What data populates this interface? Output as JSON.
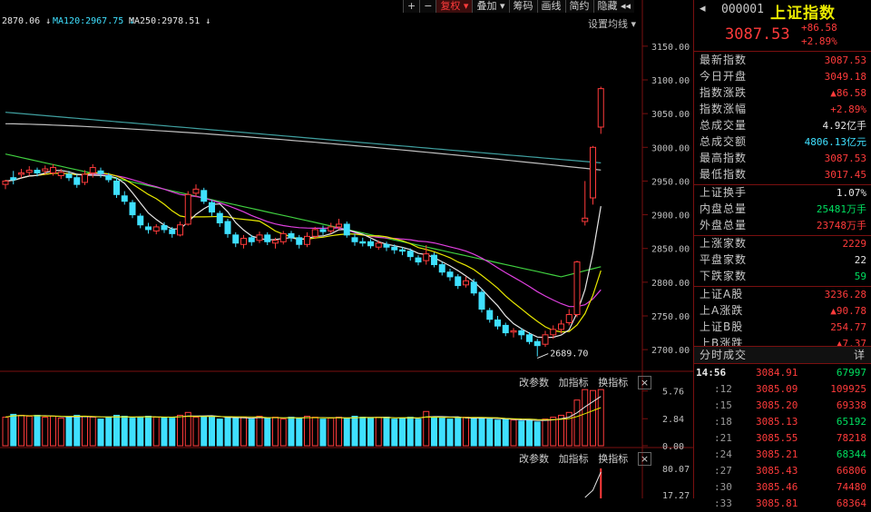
{
  "toolbar": {
    "items": [
      {
        "label": "+",
        "active": false
      },
      {
        "label": "−",
        "active": false
      },
      {
        "label": "复权 ▾",
        "active": true
      },
      {
        "label": "叠加 ▾",
        "active": false
      },
      {
        "label": "筹码",
        "active": false
      },
      {
        "label": "画线",
        "active": false
      },
      {
        "label": "简约",
        "active": false
      },
      {
        "label": "隐藏 ◂◂",
        "active": false
      }
    ]
  },
  "ma_legend": {
    "ma_a": "2870.06 ↓",
    "ma120": "MA120:2967.75 ↓",
    "ma250": "MA250:2978.51 ↓"
  },
  "settings_label": "设置均线 ▾",
  "price_axis": [
    "3150.00",
    "3100.00",
    "3050.00",
    "3000.00",
    "2950.00",
    "2900.00",
    "2850.00",
    "2800.00",
    "2750.00",
    "2700.00"
  ],
  "low_marker": "2689.70",
  "volume_axis": [
    "5.76",
    "2.84",
    "0.00"
  ],
  "indicator_axis": [
    "80.07",
    "17.27"
  ],
  "sub_toolbar": {
    "edit_params": "改参数",
    "add_indicator": "加指标",
    "switch_indicator": "换指标",
    "close": "×"
  },
  "colors": {
    "up": "#ff3b3b",
    "down": "#3fe0ff",
    "ma5": "#e6e6e6",
    "ma10": "#e8e800",
    "ma20": "#e040e0",
    "ma60": "#40d040",
    "ma120": "#bfbfbf",
    "ma250": "#40a0a0"
  },
  "chart_data": {
    "type": "candlestick",
    "ylim": [
      2680,
      3170
    ],
    "candles": [
      [
        2945,
        2950,
        2938,
        2952
      ],
      [
        2955,
        2952,
        2945,
        2965
      ],
      [
        2960,
        2962,
        2955,
        2968
      ],
      [
        2963,
        2966,
        2958,
        2972
      ],
      [
        2966,
        2962,
        2957,
        2970
      ],
      [
        2965,
        2968,
        2960,
        2973
      ],
      [
        2962,
        2970,
        2958,
        2975
      ],
      [
        2958,
        2963,
        2953,
        2968
      ],
      [
        2960,
        2955,
        2950,
        2965
      ],
      [
        2955,
        2945,
        2940,
        2960
      ],
      [
        2948,
        2960,
        2944,
        2966
      ],
      [
        2962,
        2970,
        2955,
        2975
      ],
      [
        2965,
        2961,
        2955,
        2970
      ],
      [
        2958,
        2952,
        2948,
        2962
      ],
      [
        2950,
        2930,
        2925,
        2955
      ],
      [
        2928,
        2920,
        2915,
        2935
      ],
      [
        2918,
        2900,
        2895,
        2922
      ],
      [
        2898,
        2885,
        2880,
        2902
      ],
      [
        2882,
        2878,
        2872,
        2888
      ],
      [
        2876,
        2882,
        2871,
        2886
      ],
      [
        2884,
        2878,
        2873,
        2889
      ],
      [
        2878,
        2872,
        2866,
        2882
      ],
      [
        2870,
        2885,
        2868,
        2890
      ],
      [
        2886,
        2930,
        2884,
        2935
      ],
      [
        2932,
        2938,
        2926,
        2945
      ],
      [
        2936,
        2920,
        2916,
        2940
      ],
      [
        2918,
        2904,
        2898,
        2922
      ],
      [
        2902,
        2888,
        2882,
        2906
      ],
      [
        2890,
        2872,
        2866,
        2894
      ],
      [
        2870,
        2858,
        2852,
        2874
      ],
      [
        2856,
        2865,
        2850,
        2870
      ],
      [
        2866,
        2860,
        2854,
        2870
      ],
      [
        2862,
        2870,
        2858,
        2875
      ],
      [
        2870,
        2860,
        2855,
        2874
      ],
      [
        2858,
        2862,
        2850,
        2866
      ],
      [
        2860,
        2872,
        2856,
        2876
      ],
      [
        2872,
        2866,
        2860,
        2876
      ],
      [
        2866,
        2856,
        2850,
        2870
      ],
      [
        2856,
        2868,
        2852,
        2874
      ],
      [
        2868,
        2878,
        2864,
        2882
      ],
      [
        2878,
        2875,
        2870,
        2884
      ],
      [
        2876,
        2882,
        2872,
        2888
      ],
      [
        2882,
        2886,
        2878,
        2894
      ],
      [
        2886,
        2870,
        2866,
        2890
      ],
      [
        2866,
        2860,
        2854,
        2872
      ],
      [
        2860,
        2858,
        2853,
        2866
      ],
      [
        2860,
        2854,
        2850,
        2864
      ],
      [
        2852,
        2858,
        2848,
        2862
      ],
      [
        2856,
        2852,
        2846,
        2860
      ],
      [
        2852,
        2848,
        2842,
        2856
      ],
      [
        2848,
        2846,
        2840,
        2852
      ],
      [
        2846,
        2838,
        2832,
        2850
      ],
      [
        2836,
        2830,
        2825,
        2840
      ],
      [
        2832,
        2842,
        2826,
        2855
      ],
      [
        2840,
        2826,
        2822,
        2844
      ],
      [
        2826,
        2815,
        2810,
        2830
      ],
      [
        2815,
        2808,
        2802,
        2820
      ],
      [
        2808,
        2795,
        2790,
        2812
      ],
      [
        2796,
        2802,
        2792,
        2808
      ],
      [
        2800,
        2784,
        2780,
        2805
      ],
      [
        2785,
        2760,
        2755,
        2790
      ],
      [
        2758,
        2745,
        2740,
        2762
      ],
      [
        2744,
        2735,
        2730,
        2750
      ],
      [
        2736,
        2725,
        2720,
        2740
      ],
      [
        2726,
        2728,
        2718,
        2732
      ],
      [
        2728,
        2722,
        2715,
        2732
      ],
      [
        2722,
        2712,
        2708,
        2726
      ],
      [
        2712,
        2706,
        2690,
        2716
      ],
      [
        2708,
        2722,
        2704,
        2728
      ],
      [
        2722,
        2730,
        2716,
        2736
      ],
      [
        2730,
        2738,
        2724,
        2744
      ],
      [
        2740,
        2752,
        2736,
        2760
      ],
      [
        2752,
        2830,
        2748,
        2832
      ],
      [
        2890,
        2895,
        2884,
        2950
      ],
      [
        2925,
        3000,
        2915,
        3002
      ],
      [
        3030,
        3087,
        3020,
        3090
      ]
    ],
    "volumes": [
      3.0,
      3.3,
      3.2,
      3.1,
      3.2,
      3.0,
      3.1,
      2.9,
      3.0,
      3.2,
      3.1,
      3.0,
      2.8,
      3.0,
      3.2,
      3.1,
      2.9,
      3.0,
      3.1,
      3.0,
      3.0,
      2.9,
      3.2,
      3.5,
      3.0,
      3.1,
      3.0,
      2.8,
      3.0,
      2.9,
      3.0,
      2.8,
      3.1,
      2.9,
      3.0,
      2.8,
      3.0,
      2.9,
      3.1,
      3.0,
      2.8,
      2.9,
      3.0,
      2.9,
      3.1,
      3.0,
      2.9,
      3.0,
      3.0,
      2.8,
      2.9,
      3.0,
      2.8,
      3.6,
      3.0,
      2.9,
      2.8,
      2.9,
      3.0,
      2.9,
      2.9,
      2.8,
      2.7,
      2.8,
      2.7,
      2.6,
      2.7,
      2.5,
      2.8,
      3.0,
      3.2,
      3.5,
      4.8,
      5.9,
      5.8,
      5.9
    ],
    "indicator_last": [
      60,
      80.07
    ]
  },
  "panel": {
    "code": "000001",
    "name": "上证指数",
    "price": "3087.53",
    "change": "+86.58",
    "change_pct": "+2.89%",
    "stats1": [
      {
        "label": "最新指数",
        "value": "3087.53",
        "color": "red"
      },
      {
        "label": "今日开盘",
        "value": "3049.18",
        "color": "red"
      },
      {
        "label": "指数涨跌",
        "value": "▲86.58",
        "color": "red"
      },
      {
        "label": "指数涨幅",
        "value": "+2.89%",
        "color": "red"
      },
      {
        "label": "总成交量",
        "value": "4.92亿手",
        "color": "white"
      },
      {
        "label": "总成交额",
        "value": "4806.13亿元",
        "color": "cyan"
      },
      {
        "label": "最高指数",
        "value": "3087.53",
        "color": "red"
      },
      {
        "label": "最低指数",
        "value": "3017.45",
        "color": "red"
      }
    ],
    "stats2": [
      {
        "label": "上证换手",
        "value": "1.07%",
        "color": "white"
      },
      {
        "label": "内盘总量",
        "value": "25481万手",
        "color": "green"
      },
      {
        "label": "外盘总量",
        "value": "23748万手",
        "color": "red"
      }
    ],
    "stats3": [
      {
        "label": "上涨家数",
        "value": "2229",
        "color": "red"
      },
      {
        "label": "平盘家数",
        "value": "22",
        "color": "white"
      },
      {
        "label": "下跌家数",
        "value": "59",
        "color": "green"
      }
    ],
    "stats4": [
      {
        "label": "上证A股",
        "value": "3236.28",
        "color": "red"
      },
      {
        "label": "上A涨跌",
        "value": "▲90.78",
        "color": "red"
      },
      {
        "label": "上证B股",
        "value": "254.77",
        "color": "red"
      },
      {
        "label": "上B涨跌",
        "value": "▲7.37",
        "color": "red"
      }
    ],
    "trades_title": "分时成交",
    "trades_detail": "详",
    "trades": [
      {
        "time": "14:56",
        "price": "3084.91",
        "vol": "67997",
        "vcolor": "green",
        "pcolor": "red",
        "first": true
      },
      {
        "time": ":12",
        "price": "3085.09",
        "vol": "109925",
        "vcolor": "red",
        "pcolor": "red"
      },
      {
        "time": ":15",
        "price": "3085.20",
        "vol": "69338",
        "vcolor": "red",
        "pcolor": "red"
      },
      {
        "time": ":18",
        "price": "3085.13",
        "vol": "65192",
        "vcolor": "green",
        "pcolor": "red"
      },
      {
        "time": ":21",
        "price": "3085.55",
        "vol": "78218",
        "vcolor": "red",
        "pcolor": "red"
      },
      {
        "time": ":24",
        "price": "3085.21",
        "vol": "68344",
        "vcolor": "green",
        "pcolor": "red"
      },
      {
        "time": ":27",
        "price": "3085.43",
        "vol": "66806",
        "vcolor": "red",
        "pcolor": "red"
      },
      {
        "time": ":30",
        "price": "3085.46",
        "vol": "74480",
        "vcolor": "red",
        "pcolor": "red"
      },
      {
        "time": ":33",
        "price": "3085.81",
        "vol": "68364",
        "vcolor": "red",
        "pcolor": "red"
      }
    ]
  }
}
